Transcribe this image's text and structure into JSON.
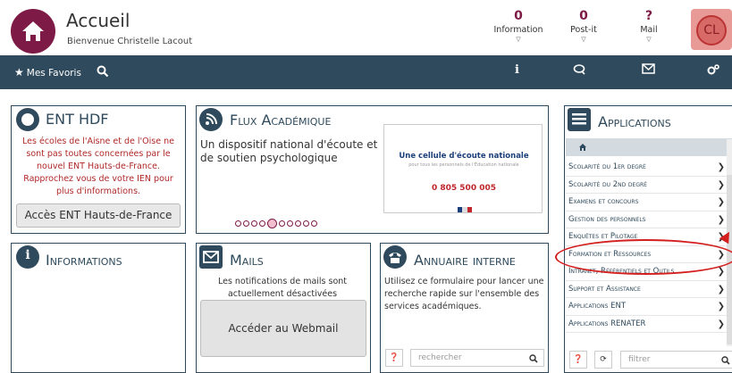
{
  "header": {
    "title": "Accueil",
    "welcome": "Bienvenue Christelle Lacout",
    "stats": [
      {
        "count": "0",
        "label": "Information"
      },
      {
        "count": "0",
        "label": "Post-it"
      },
      {
        "count": "?",
        "label": "Mail"
      }
    ],
    "avatar_initials": "CL"
  },
  "navbar": {
    "favorites_label": "Mes Favoris"
  },
  "ent": {
    "title": "ENT HDF",
    "message": "Les écoles de l'Aisne et de l'Oise ne sont pas toutes concernées par le nouvel ENT Hauts-de-France. Rapprochez vous de votre IEN pour plus d'informations.",
    "button": "Accès ENT Hauts-de-France"
  },
  "flux": {
    "title": "Flux Académique",
    "text": "Un dispositif national d'écoute et de soutien psychologique",
    "card_title": "Une cellule d'écoute nationale",
    "card_subtitle": "pour tous les personnels de l'Éducation nationale",
    "card_phone": "0 805 500 005",
    "slides_total": 10,
    "slide_active": 5
  },
  "informations": {
    "title": "Informations"
  },
  "mails": {
    "title": "Mails",
    "message": "Les notifications de mails sont actuellement désactivées",
    "button": "Accéder au Webmail"
  },
  "annuaire": {
    "title": "Annuaire interne",
    "message": "Utilisez ce formulaire pour lancer une recherche rapide sur l'ensemble des services académiques.",
    "search_placeholder": "rechercher"
  },
  "applications": {
    "title": "Applications",
    "items": [
      {
        "label": "Scolarité du 1er degré"
      },
      {
        "label": "Scolarité du 2nd degré"
      },
      {
        "label": "Examens et concours"
      },
      {
        "label": "Gestion des personnels"
      },
      {
        "label": "Enquêtes et Pilotage"
      },
      {
        "label": "Formation et Ressources"
      },
      {
        "label": "Intranet, Référentiels et Outils"
      },
      {
        "label": "Support et Assistance"
      },
      {
        "label": "Applications ENT"
      },
      {
        "label": "Applications RENATER"
      }
    ],
    "filter_placeholder": "filtrer"
  },
  "colors": {
    "brand": "#7d1a46",
    "navbar": "#2f4a5c",
    "alert_text": "#b02828",
    "highlight_oval": "#d41f1f"
  }
}
